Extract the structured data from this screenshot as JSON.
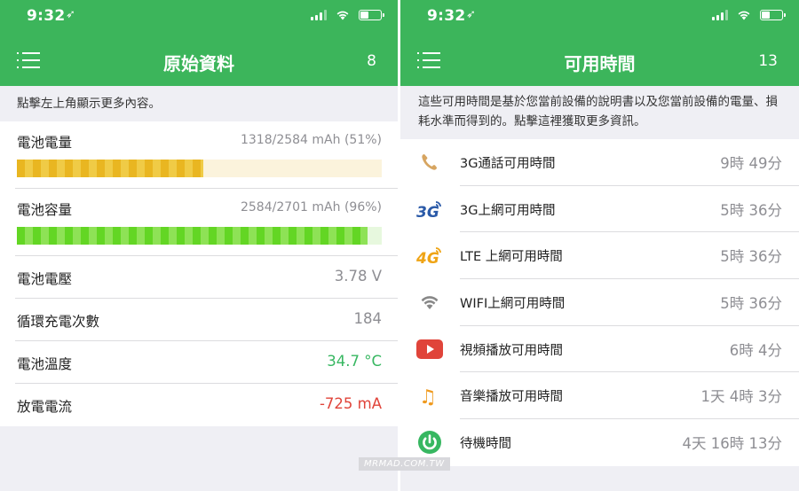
{
  "status_bar": {
    "time": "9:32",
    "location_glyph": "➶"
  },
  "left_screen": {
    "title": "原始資料",
    "count": "8",
    "note": "點擊左上角顯示更多內容。",
    "bars": [
      {
        "label": "電池電量",
        "value": "1318/2584 mAh (51%)",
        "fraction": 0.51,
        "color": "#e9b621"
      },
      {
        "label": "電池容量",
        "value": "2584/2701 mAh (96%)",
        "fraction": 0.96,
        "color": "#63d624"
      }
    ],
    "rows": [
      {
        "label": "電池電壓",
        "value": "3.78 V"
      },
      {
        "label": "循環充電次數",
        "value": "184"
      },
      {
        "label": "電池溫度",
        "value": "34.7 °C",
        "color": "#37b761"
      },
      {
        "label": "放電電流",
        "value": "-725 mA",
        "color": "#e0443a"
      }
    ]
  },
  "right_screen": {
    "title": "可用時間",
    "count": "13",
    "note": "這些可用時間是基於您當前設備的說明書以及您當前設備的電量、損耗水準而得到的。點擊這裡獲取更多資訊。",
    "items": [
      {
        "icon": "phone-icon",
        "label": "3G通話可用時間",
        "value": "9時 49分"
      },
      {
        "icon": "3g-icon",
        "icon_text": "3G",
        "label": "3G上網可用時間",
        "value": "5時 36分"
      },
      {
        "icon": "4g-icon",
        "icon_text": "4G",
        "label": "LTE 上網可用時間",
        "value": "5時 36分"
      },
      {
        "icon": "wifi-icon",
        "label": "WIFI上網可用時間",
        "value": "5時 36分"
      },
      {
        "icon": "video-play-icon",
        "label": "視頻播放可用時間",
        "value": "6時 4分"
      },
      {
        "icon": "music-note-icon",
        "icon_text": "♫",
        "label": "音樂播放可用時間",
        "value": "1天 4時 3分"
      },
      {
        "icon": "power-icon",
        "label": "待機時間",
        "value": "4天 16時 13分"
      }
    ]
  },
  "watermark": "MRMAD.COM.TW",
  "colors": {
    "header_green": "#3cb55b",
    "background": "#efeff4",
    "accent_green": "#37b761",
    "accent_red": "#e0443a"
  }
}
